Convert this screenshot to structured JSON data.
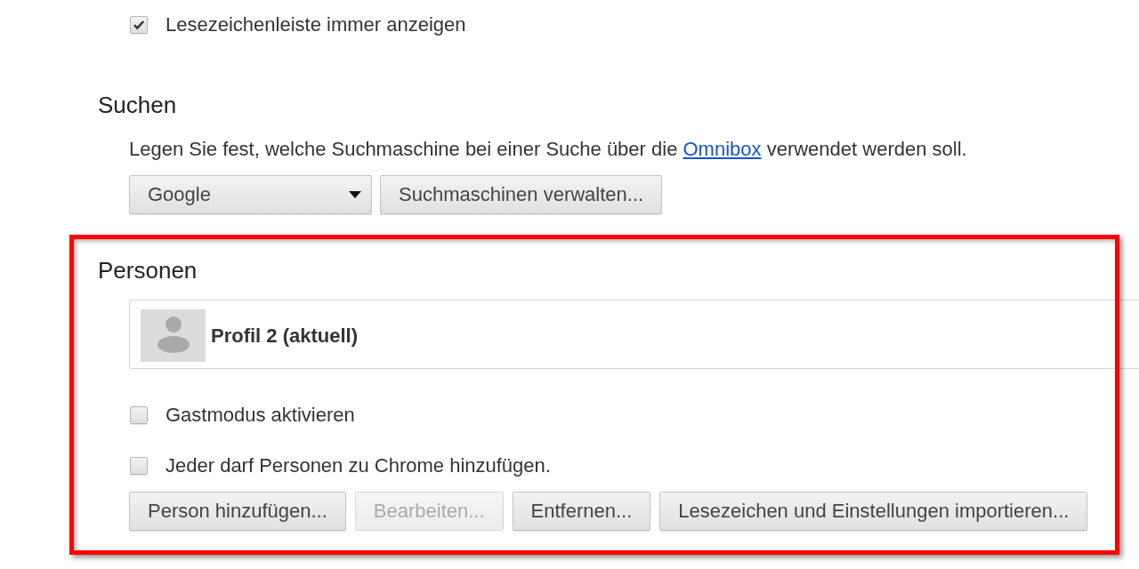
{
  "bookmark_bar_option": {
    "label": "Lesezeichenleiste immer anzeigen",
    "checked": true
  },
  "search": {
    "title": "Suchen",
    "description": {
      "before": "Legen Sie fest, welche Suchmaschine bei einer Suche über die",
      "link": "Omnibox",
      "after": "verwendet werden soll."
    },
    "engine_select": {
      "value": "Google"
    },
    "buttons": [
      {
        "label": "Suchmaschinen verwalten...",
        "disabled": false
      }
    ]
  },
  "people": {
    "title": "Personen",
    "highlighted": true,
    "profiles": [
      {
        "name": "Profil 2 (aktuell)",
        "selected": false
      }
    ],
    "options": [
      {
        "label": "Gastmodus aktivieren",
        "checked": false
      },
      {
        "label": "Jeder darf Personen zu Chrome hinzufügen.",
        "checked": false
      }
    ],
    "buttons": [
      {
        "label": "Person hinzufügen...",
        "disabled": false
      },
      {
        "label": "Bearbeiten...",
        "disabled": true
      },
      {
        "label": "Entfernen...",
        "disabled": false
      },
      {
        "label": "Lesezeichen und Einstellungen importieren...",
        "disabled": false
      }
    ]
  }
}
